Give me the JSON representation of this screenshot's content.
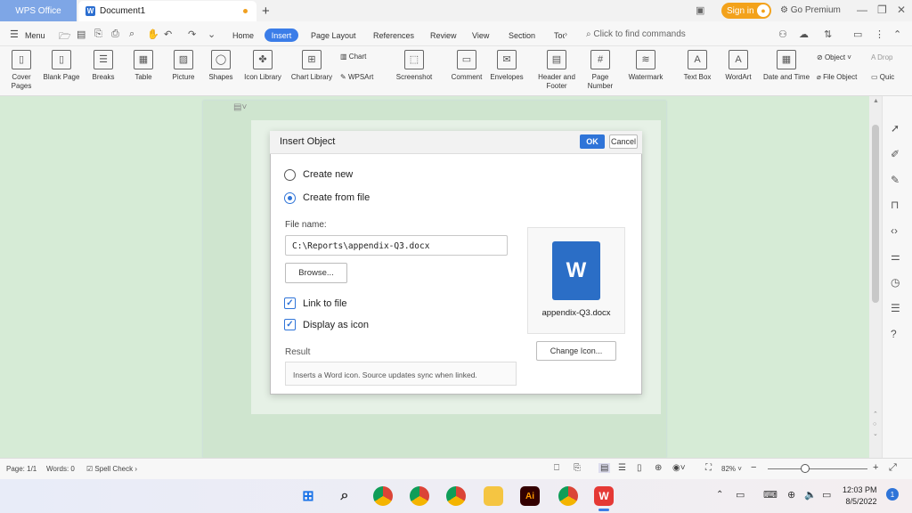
{
  "titlebar": {
    "app_name": "WPS Office",
    "doc_tab": "Document1",
    "new_tab": "+",
    "sign_in": "Sign in",
    "go_premium": "Go Premium",
    "min": "—",
    "restore": "❐",
    "close": "✕"
  },
  "menu": {
    "menu_label": "Menu",
    "tabs": [
      "Home",
      "Insert",
      "Page Layout",
      "References",
      "Review",
      "View",
      "Section",
      "Toc"
    ],
    "command_search": "Click to find commands"
  },
  "ribbon": {
    "items": [
      "Cover Pages",
      "Blank Page",
      "Breaks",
      "Table",
      "Picture",
      "Shapes",
      "Icon Library",
      "Chart Library",
      "Chart",
      "WPSArt",
      "Screenshot",
      "Comment",
      "Envelopes",
      "Header and Footer",
      "Page Number",
      "Watermark",
      "Text Box",
      "WordArt",
      "Date and Time",
      "Object",
      "File Object",
      "Drop",
      "Quic"
    ]
  },
  "dialog": {
    "title": "Insert Object",
    "ok": "OK",
    "cancel": "Cancel",
    "create_new": "Create new",
    "create_from_file": "Create from file",
    "file_name_label": "File name:",
    "file_name_value": "C:\\Reports\\appendix-Q3.docx",
    "browse": "Browse...",
    "link_to_file": "Link to file",
    "display_as_icon": "Display as icon",
    "result_label": "Result",
    "result_text": "Inserts a Word icon. Source updates sync when linked.",
    "preview_letter": "W",
    "preview_filename": "appendix-Q3.docx",
    "change_icon": "Change Icon..."
  },
  "statusbar": {
    "page": "Page: 1/1",
    "words": "Words: 0",
    "spell_check": "Spell Check",
    "zoom": "82%"
  },
  "taskbar": {
    "time": "12:03 PM",
    "date": "8/5/2022",
    "notification_count": "1"
  },
  "colors": {
    "accent": "#2f74d8",
    "premium": "#f3a21b",
    "doc_bg": "#d6ebd6"
  }
}
